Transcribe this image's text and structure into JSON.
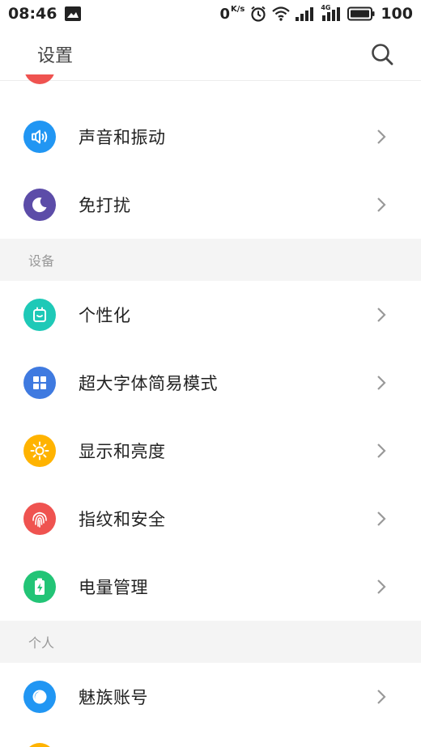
{
  "status_bar": {
    "time": "08:46",
    "speed_value": "0",
    "speed_unit": "K/s",
    "battery": "100",
    "network_tag": "4G"
  },
  "app_bar": {
    "title": "设置"
  },
  "sections": [
    {
      "header": "",
      "items": [
        {
          "label": "声音和振动",
          "icon": "speaker-icon",
          "color": "#2196f3"
        },
        {
          "label": "免打扰",
          "icon": "moon-icon",
          "color": "#5c4ca8"
        }
      ]
    },
    {
      "header": "设备",
      "items": [
        {
          "label": "个性化",
          "icon": "theme-icon",
          "color": "#1ec9b7"
        },
        {
          "label": "超大字体简易模式",
          "icon": "grid-icon",
          "color": "#3f7ae0"
        },
        {
          "label": "显示和亮度",
          "icon": "sun-icon",
          "color": "#ffb300"
        },
        {
          "label": "指纹和安全",
          "icon": "fingerprint-icon",
          "color": "#ef5350"
        },
        {
          "label": "电量管理",
          "icon": "battery-icon",
          "color": "#22c476"
        }
      ]
    },
    {
      "header": "个人",
      "items": [
        {
          "label": "魅族账号",
          "icon": "account-icon",
          "color": "#2196f3"
        }
      ]
    }
  ]
}
